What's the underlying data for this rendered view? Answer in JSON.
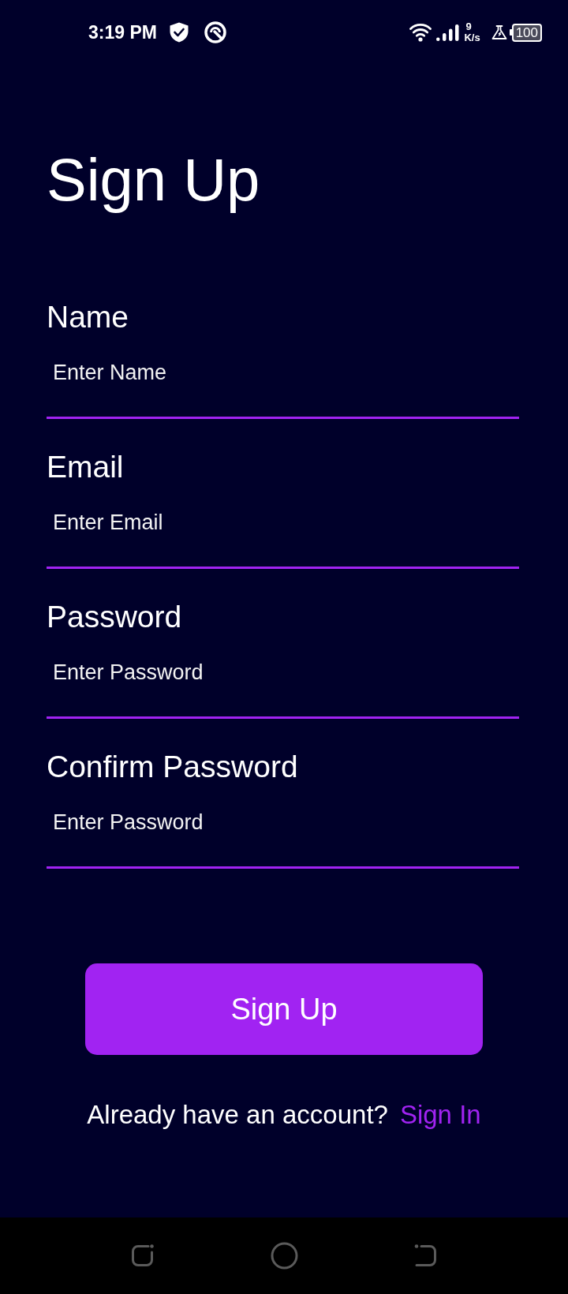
{
  "status_bar": {
    "time": "3:19 PM",
    "network_speed": "9",
    "network_speed_unit": "K/s",
    "battery": "100"
  },
  "title": "Sign Up",
  "fields": [
    {
      "label": "Name",
      "placeholder": "Enter Name"
    },
    {
      "label": "Email",
      "placeholder": "Enter Email"
    },
    {
      "label": "Password",
      "placeholder": "Enter Password"
    },
    {
      "label": "Confirm Password",
      "placeholder": "Enter Password"
    }
  ],
  "submit_button": {
    "label": "Sign Up"
  },
  "footer": {
    "prompt": "Already have an account?",
    "link": "Sign In"
  }
}
